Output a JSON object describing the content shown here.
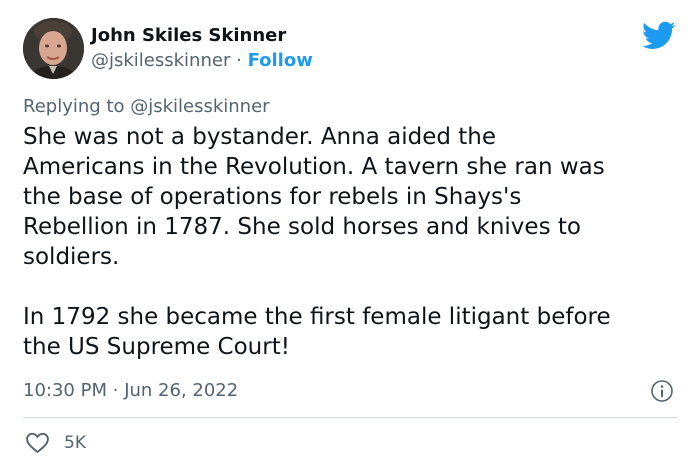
{
  "author": {
    "display_name": "John Skiles Skinner",
    "handle": "@jskilesskinner",
    "separator": "·",
    "follow_label": "Follow"
  },
  "reply": {
    "prefix": "Replying to",
    "handle": "@jskilesskinner"
  },
  "tweet": {
    "lines": [
      "She was not a bystander. Anna aided the",
      "Americans in the Revolution. A tavern she ran was",
      "the base of operations for rebels in Shays's",
      "Rebellion in 1787. She sold horses and knives to",
      "soldiers.",
      "In 1792 she became the first female litigant before",
      "the US Supreme Court!"
    ]
  },
  "meta": {
    "time": "10:30 PM",
    "separator": "·",
    "date": "Jun 26, 2022"
  },
  "actions": {
    "like_count": "5K"
  },
  "icons": {
    "bird": "twitter-bird-icon",
    "info": "info-icon",
    "heart": "heart-icon"
  },
  "colors": {
    "accent": "#1d9bf0",
    "text": "#0f1419",
    "secondary": "#536471",
    "divider": "#cfd9de"
  }
}
